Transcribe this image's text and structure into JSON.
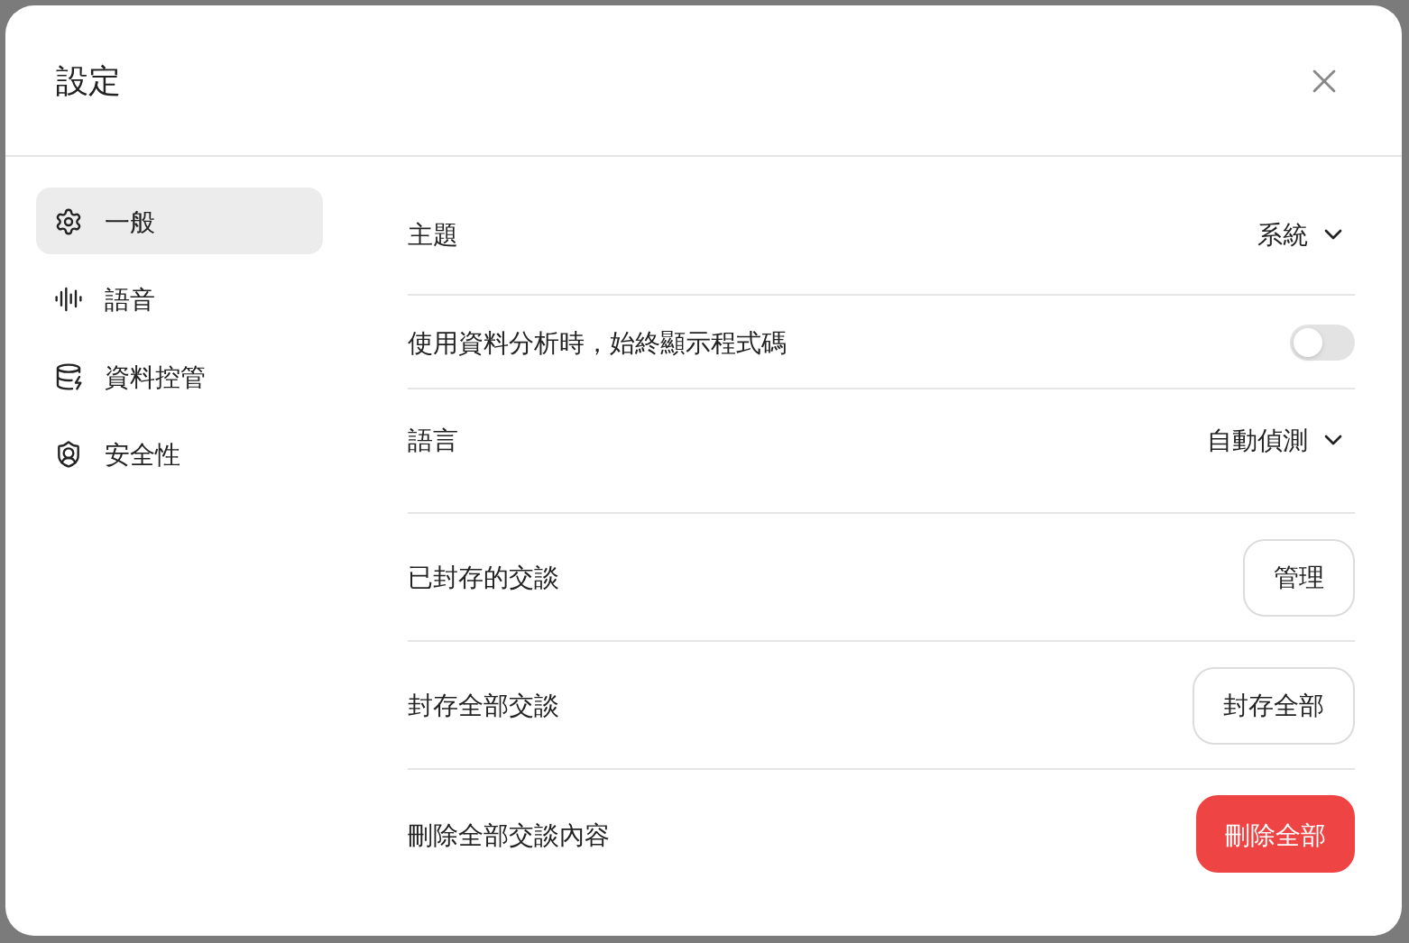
{
  "dialog": {
    "title": "設定"
  },
  "sidebar": {
    "items": [
      {
        "label": "一般",
        "selected": true
      },
      {
        "label": "語音",
        "selected": false
      },
      {
        "label": "資料控管",
        "selected": false
      },
      {
        "label": "安全性",
        "selected": false
      }
    ]
  },
  "settings": [
    {
      "kind": "select",
      "label": "主題",
      "value": "系統"
    },
    {
      "kind": "toggle",
      "label": "使用資料分析時，始終顯示程式碼",
      "on": false
    },
    {
      "kind": "select",
      "label": "語言",
      "value": "自動偵測"
    },
    {
      "kind": "button",
      "label": "已封存的交談",
      "button": "管理",
      "danger": false
    },
    {
      "kind": "button",
      "label": "封存全部交談",
      "button": "封存全部",
      "danger": false
    },
    {
      "kind": "button",
      "label": "刪除全部交談內容",
      "button": "刪除全部",
      "danger": true
    }
  ]
}
